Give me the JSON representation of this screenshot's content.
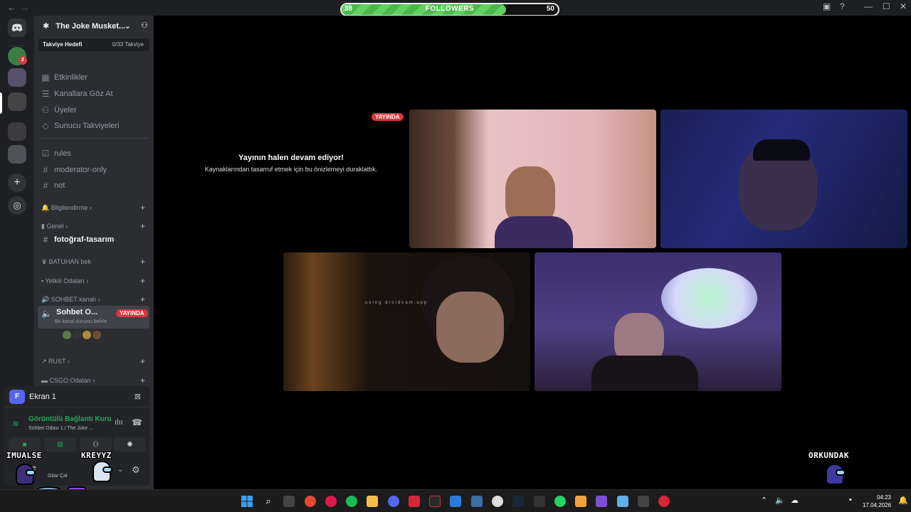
{
  "followers": {
    "current": "38",
    "label": "FOLLOWERS",
    "goal": "50",
    "fraction": 0.76
  },
  "kick": {
    "count": "7"
  },
  "server": {
    "name": "The Joke Musket...",
    "boost_label": "Takviye Hedefi",
    "boost_count": "0/33 Takviye"
  },
  "nav_items": [
    "Etkinlikler",
    "Kanallara Göz At",
    "Üyeler",
    "Sunucu Takviyeleri"
  ],
  "channels": [
    "rules",
    "moderator-only",
    "not"
  ],
  "categories": {
    "bilgilendirme": "Bilgilendirme",
    "genel": "Genel",
    "foto_channel": "fotoğraf-tasarım",
    "batuhan": "BATUHAN bek",
    "yetkili": "Yetkili Odaları",
    "sohbet": "SOHBET kanalı",
    "rust": "RUST",
    "csgo": "CSGO Odaları"
  },
  "voice_channel": {
    "name": "Sohbet O...",
    "live": "YAYINDA",
    "status": "Bir kanal durumu belirle"
  },
  "screen_share": {
    "label": "Ekran 1"
  },
  "connection": {
    "title": "Görüntülü Bağlantı Kuru",
    "subtitle": "Sohbet Odası 1 / The Joke ..."
  },
  "user": {
    "name": "se",
    "status": "Gitar Çal"
  },
  "stage": {
    "live_tag": "YAYINDA",
    "paused_title": "Yayının halen devam ediyor!",
    "paused_sub": "Kaynaklarından tasarruf etmek için bu önizlemeyi duraklattık.",
    "watermark": "using droidcam.app"
  },
  "overlay_names": {
    "left": "IMUALSE",
    "mid": "KREYYZ",
    "right": "ORKUNDAK"
  },
  "clock": {
    "time": "04:23",
    "date": "17.04.2026"
  },
  "colors": {
    "live_red": "#da373c",
    "kick_green": "#53fc18",
    "discord_blurple": "#5865f2"
  }
}
